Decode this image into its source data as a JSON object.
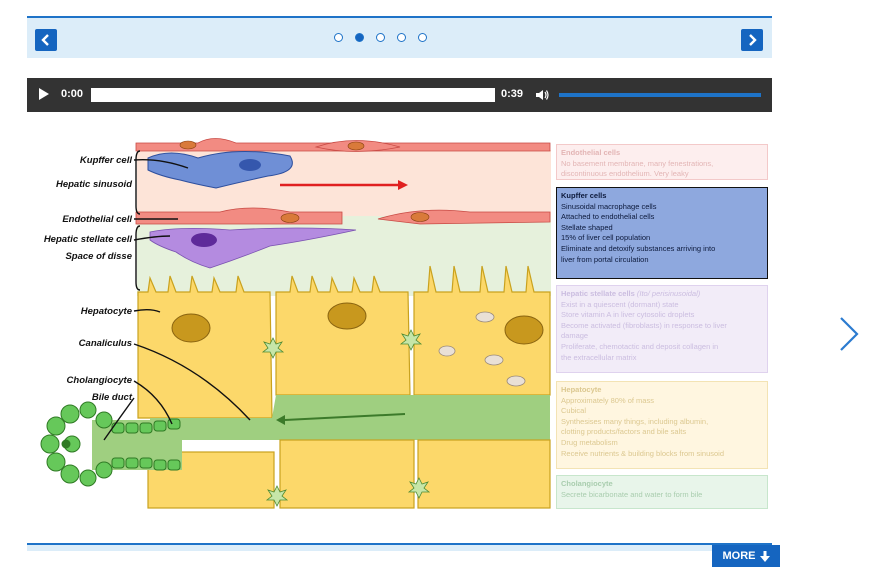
{
  "carousel": {
    "prev_label": "previous",
    "next_label": "next",
    "dot_count": 5,
    "active_index": 1
  },
  "audio": {
    "current_time": "0:00",
    "duration": "0:39",
    "progress": 0,
    "volume": 1.0
  },
  "diagram": {
    "labels": {
      "kupffer": "Kupffer cell",
      "sinusoid": "Hepatic sinusoid",
      "endothelial": "Endothelial cell",
      "stellate": "Hepatic stellate cell",
      "disse": "Space of disse",
      "hepatocyte": "Hepatocyte",
      "canaliculus": "Canaliculus",
      "cholangiocyte": "Cholangiocyte",
      "bileduct": "Bile duct"
    },
    "panels": {
      "endothelial": {
        "title": "Endothelial cells",
        "lines": [
          "No basement membrane, many fenestrations,",
          "discontinuous endothelium. Very leaky"
        ]
      },
      "kupffer": {
        "title": "Kupffer cells",
        "lines": [
          "Sinusoidal macrophage cells",
          "Attached to endothelial cells",
          "Stellate shaped",
          "15% of liver cell population",
          "Eliminate and detoxify substances arriving into",
          "liver from portal circulation"
        ]
      },
      "stellate": {
        "title": "Hepatic stellate cells",
        "title_extra": "(Ito/ perisinusoidal)",
        "lines": [
          "Exist in a quiescent (dormant) state",
          "Store vitamin A in liver cytosolic droplets",
          "Become activated (fibroblasts) in response to liver",
          "damage",
          "Proliferate, chemotactic and deposit collagen in",
          "the extracellular matrix"
        ]
      },
      "hepatocyte": {
        "title": "Hepatocyte",
        "lines": [
          "Approximately 80% of mass",
          "Cubical",
          "Synthesises many things, including albumin,",
          "clotting products/factors and bile salts",
          "Drug metabolism",
          "Receive nutrients & building blocks from sinusoid"
        ]
      },
      "cholangiocyte": {
        "title": "Cholangiocyte",
        "lines": [
          "Secrete bicarbonate and water to form bile"
        ]
      }
    },
    "colors": {
      "endothelial": "#f08080",
      "kupffer": "#6f8fd6",
      "stellate": "#b48be0",
      "hepatocyte": "#fcd86a",
      "canal": "#9fcf80",
      "cholangiocyte": "#66c85a"
    }
  },
  "more_button": {
    "label": "MORE"
  }
}
